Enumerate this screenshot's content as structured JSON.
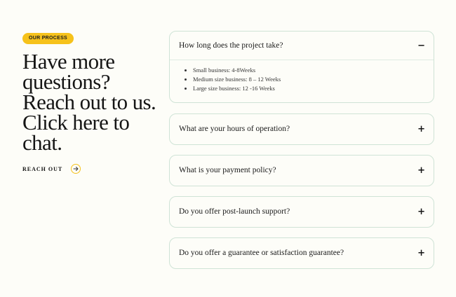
{
  "left": {
    "badge": "OUR PROCESS",
    "headline": "Have more questions? Reach out to us. Click here to chat.",
    "cta_label": "REACH OUT"
  },
  "faq": [
    {
      "question": "How long does the project take?",
      "toggle": "−",
      "answers": [
        "Small business: 4-8Weeks",
        "Medium size business: 8 – 12 Weeks",
        "Large size business: 12 -16 Weeks"
      ]
    },
    {
      "question": "What are your hours of operation?",
      "toggle": "+"
    },
    {
      "question": "What is your payment policy?",
      "toggle": "+"
    },
    {
      "question": "Do you offer post-launch support?",
      "toggle": "+"
    },
    {
      "question": "Do you offer a guarantee or satisfaction guarantee?",
      "toggle": "+"
    }
  ],
  "colors": {
    "accent": "#f6c21b",
    "border": "#cfe3d6",
    "background": "#fdfdf8"
  },
  "icons": {
    "cta": "arrow-right-icon"
  }
}
